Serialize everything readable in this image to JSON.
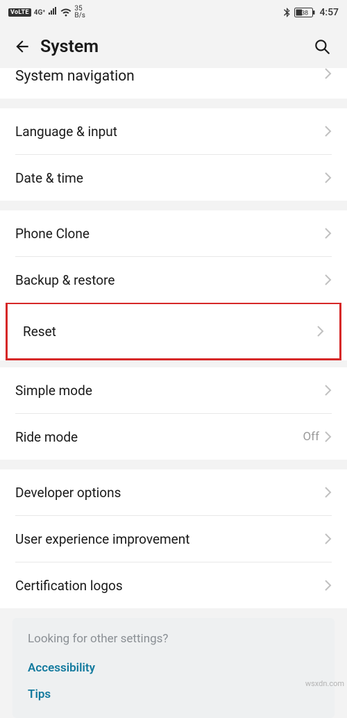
{
  "status": {
    "volte": "VoLTE",
    "net_gen": "4G⁺",
    "net_speed_top": "35",
    "net_speed_bottom": "B/s",
    "battery_pct": "38",
    "clock": "4:57"
  },
  "header": {
    "title": "System"
  },
  "partial_top_row": {
    "label": "System navigation"
  },
  "groups": [
    {
      "rows": [
        {
          "label": "Language & input",
          "value": ""
        },
        {
          "label": "Date & time",
          "value": ""
        }
      ]
    },
    {
      "rows": [
        {
          "label": "Phone Clone",
          "value": ""
        },
        {
          "label": "Backup & restore",
          "value": ""
        },
        {
          "label": "Reset",
          "value": "",
          "highlight": true
        }
      ]
    },
    {
      "rows": [
        {
          "label": "Simple mode",
          "value": ""
        },
        {
          "label": "Ride mode",
          "value": "Off"
        }
      ]
    },
    {
      "rows": [
        {
          "label": "Developer options",
          "value": ""
        },
        {
          "label": "User experience improvement",
          "value": ""
        },
        {
          "label": "Certification logos",
          "value": ""
        }
      ]
    }
  ],
  "card": {
    "title": "Looking for other settings?",
    "links": [
      "Accessibility",
      "Tips"
    ]
  },
  "accent_highlight": "#d62828",
  "watermark": "wsxdn.com"
}
